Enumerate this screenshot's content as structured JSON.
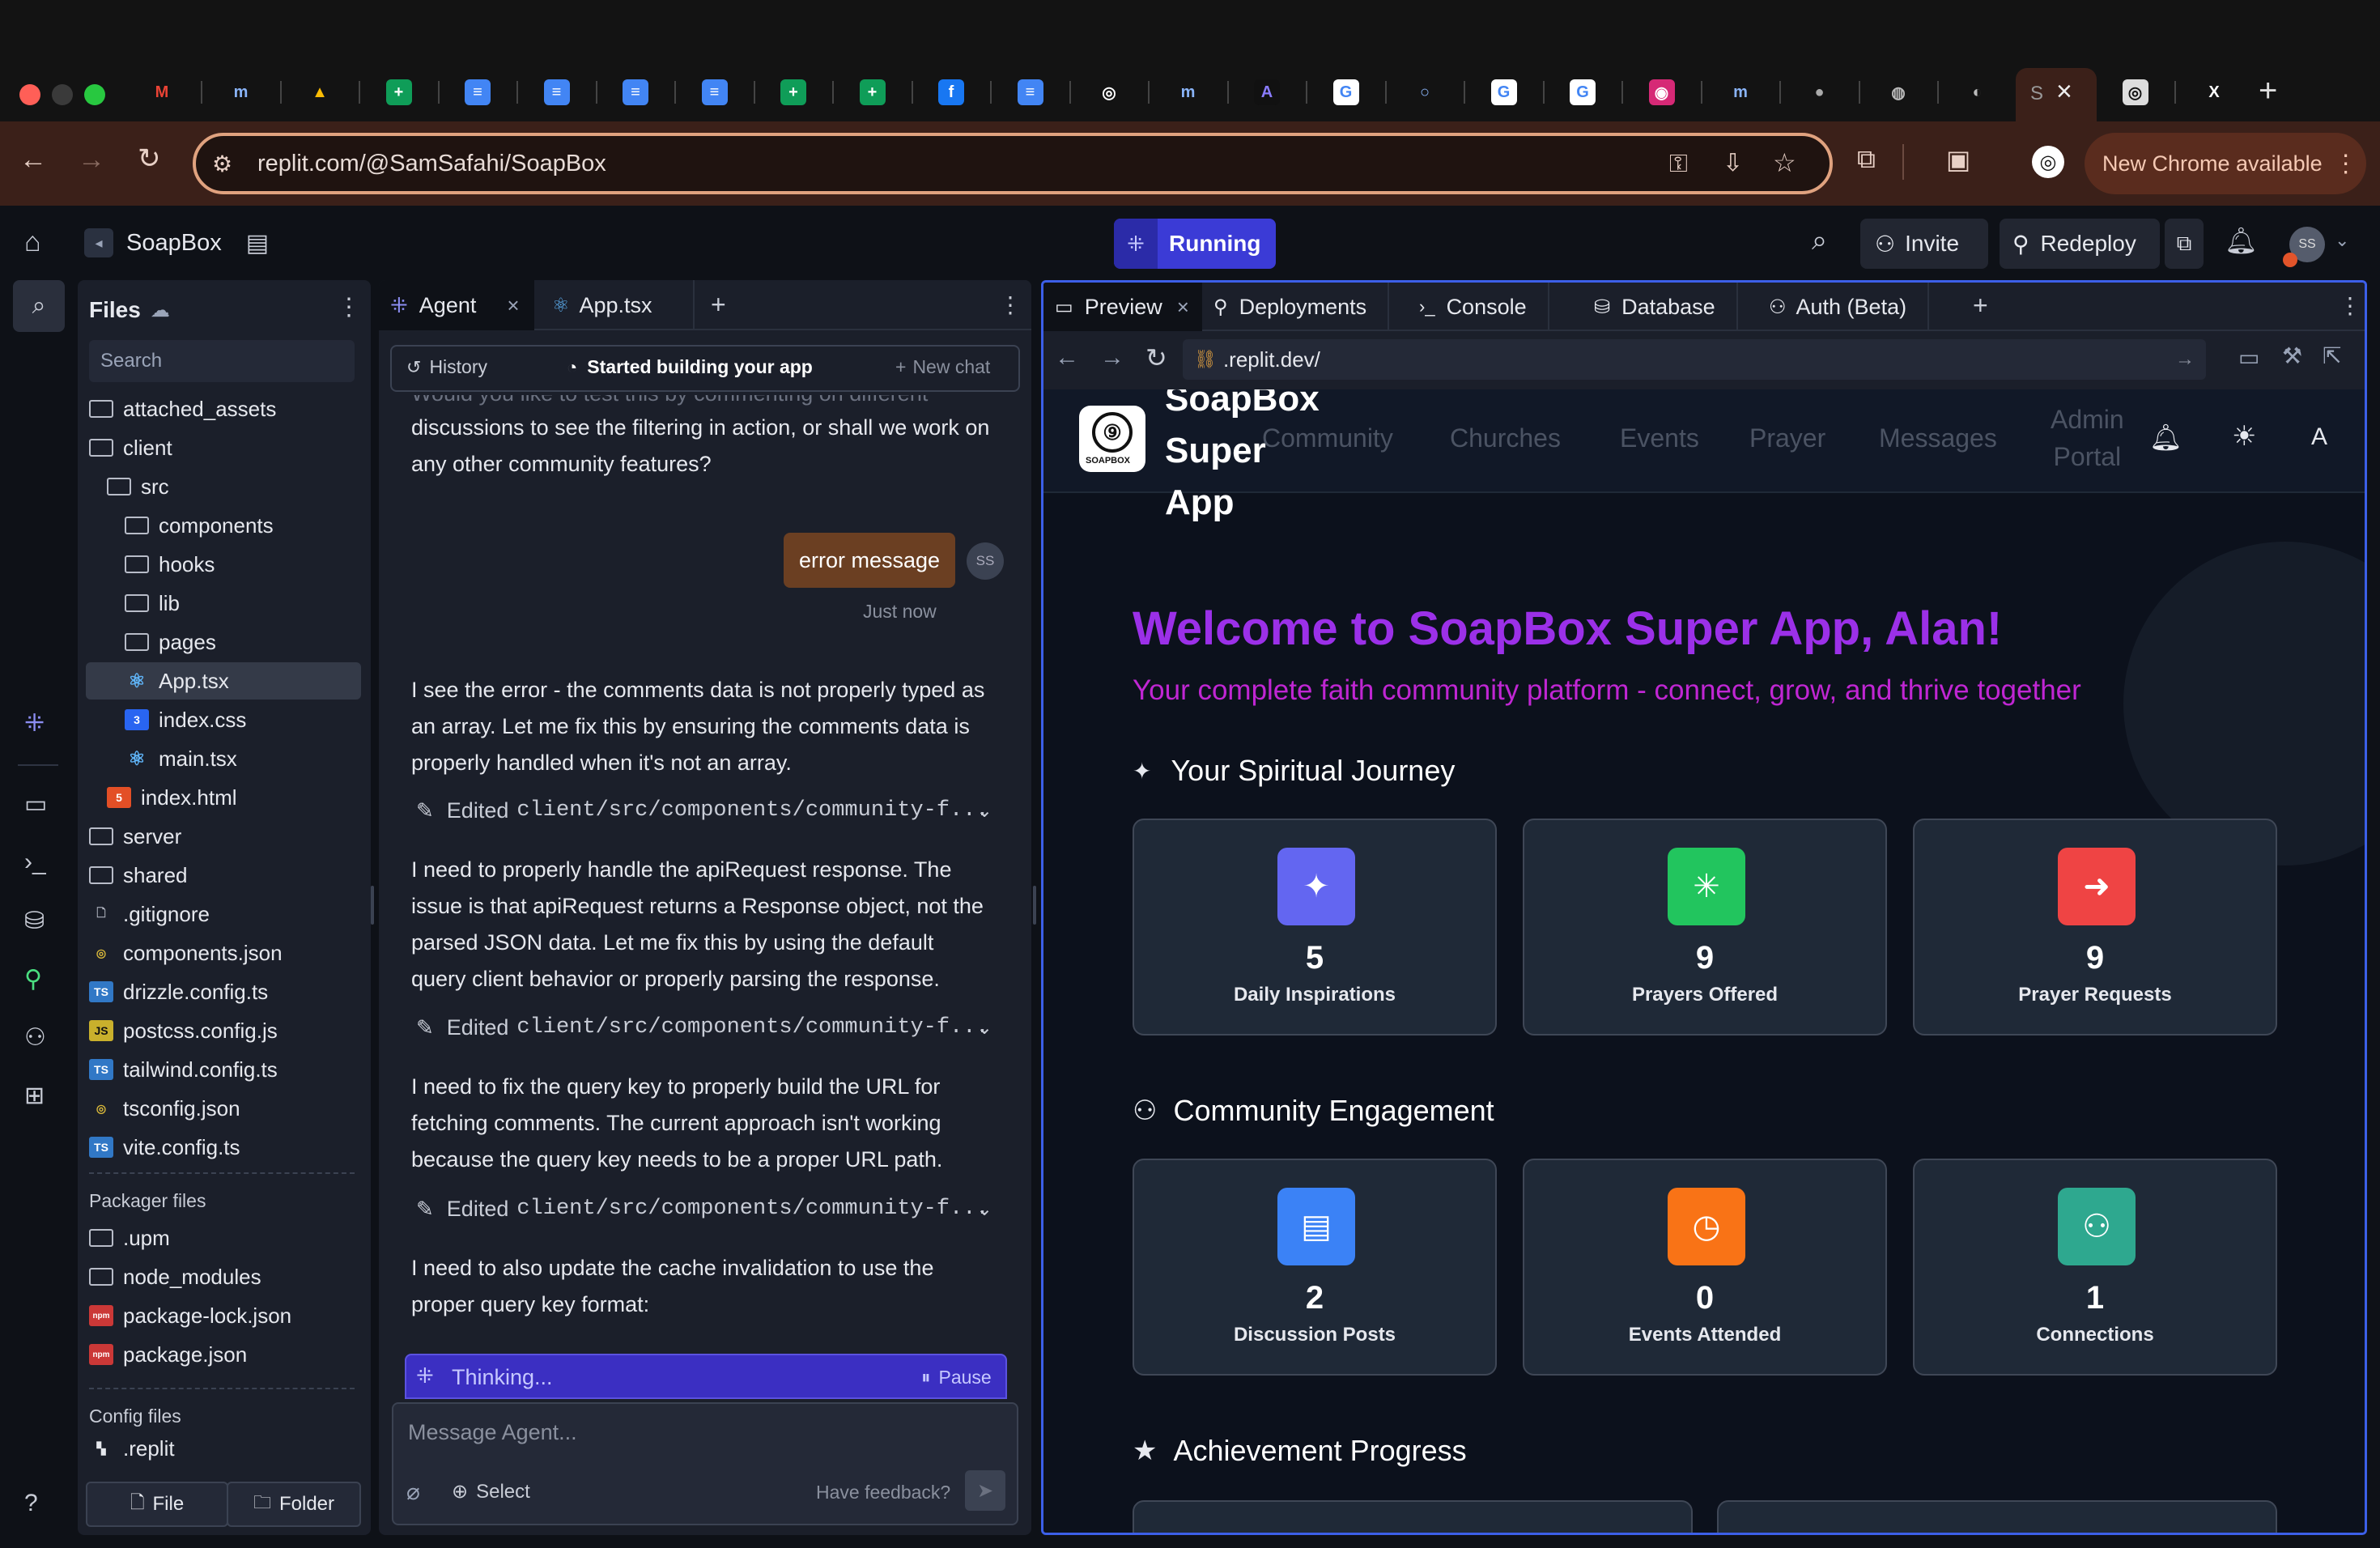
{
  "browser": {
    "url": "replit.com/@SamSafahi/SoapBox",
    "new_chrome": "New Chrome available",
    "tabs": [
      {
        "icon": "gmail-icon",
        "glyph": "M",
        "color": "#ea4335",
        "bg": "transparent"
      },
      {
        "icon": "meet-icon",
        "glyph": "m",
        "color": "#8ab4f8",
        "bg": "transparent"
      },
      {
        "icon": "drive-icon",
        "glyph": "▲",
        "color": "#fbbc04",
        "bg": "transparent"
      },
      {
        "icon": "sheets-icon",
        "glyph": "+",
        "color": "#fff",
        "bg": "#0f9d58"
      },
      {
        "icon": "docs-icon",
        "glyph": "≡",
        "color": "#fff",
        "bg": "#4285f4"
      },
      {
        "icon": "docs-icon",
        "glyph": "≡",
        "color": "#fff",
        "bg": "#4285f4"
      },
      {
        "icon": "docs-icon",
        "glyph": "≡",
        "color": "#fff",
        "bg": "#4285f4"
      },
      {
        "icon": "docs-icon",
        "glyph": "≡",
        "color": "#fff",
        "bg": "#4285f4"
      },
      {
        "icon": "sheets-icon",
        "glyph": "+",
        "color": "#fff",
        "bg": "#0f9d58"
      },
      {
        "icon": "sheets-icon",
        "glyph": "+",
        "color": "#fff",
        "bg": "#0f9d58"
      },
      {
        "icon": "facebook-icon",
        "glyph": "f",
        "color": "#fff",
        "bg": "#1877f2"
      },
      {
        "icon": "docs-icon",
        "glyph": "≡",
        "color": "#fff",
        "bg": "#4285f4"
      },
      {
        "icon": "openai-icon",
        "glyph": "◎",
        "color": "#fff",
        "bg": "transparent"
      },
      {
        "icon": "meet-icon",
        "glyph": "m",
        "color": "#8ab4f8",
        "bg": "transparent"
      },
      {
        "icon": "app-icon",
        "glyph": "A",
        "color": "#8a7cff",
        "bg": "#111"
      },
      {
        "icon": "google-icon",
        "glyph": "G",
        "color": "#4285f4",
        "bg": "#fff"
      },
      {
        "icon": "circle-icon",
        "glyph": "○",
        "color": "#8ab4f8",
        "bg": "transparent"
      },
      {
        "icon": "google-icon",
        "glyph": "G",
        "color": "#4285f4",
        "bg": "#fff"
      },
      {
        "icon": "google-icon",
        "glyph": "G",
        "color": "#4285f4",
        "bg": "#fff"
      },
      {
        "icon": "instagram-icon",
        "glyph": "◉",
        "color": "#fff",
        "bg": "#d62976"
      },
      {
        "icon": "meet-icon",
        "glyph": "m",
        "color": "#8ab4f8",
        "bg": "transparent"
      },
      {
        "icon": "apple-icon",
        "glyph": "●",
        "color": "#aaa",
        "bg": "transparent"
      },
      {
        "icon": "chrome-icon",
        "glyph": "◍",
        "color": "#bbb",
        "bg": "transparent"
      },
      {
        "icon": "globe-icon",
        "glyph": "◐",
        "color": "#bbb",
        "bg": "transparent"
      },
      {
        "icon": "replit-tab-icon",
        "glyph": "S",
        "color": "#bbb",
        "bg": "transparent"
      },
      {
        "icon": "openai-icon",
        "glyph": "◎",
        "color": "#111",
        "bg": "#ddd"
      },
      {
        "icon": "x-icon",
        "glyph": "X",
        "color": "#fff",
        "bg": "transparent"
      }
    ]
  },
  "header": {
    "project": "SoapBox",
    "status": "Running",
    "invite": "Invite",
    "redeploy": "Redeploy",
    "avatar": "SS"
  },
  "files": {
    "title": "Files",
    "search_placeholder": "Search",
    "tree": [
      {
        "name": "attached_assets",
        "type": "folder",
        "indent": 0
      },
      {
        "name": "client",
        "type": "folder",
        "indent": 0
      },
      {
        "name": "src",
        "type": "folder",
        "indent": 1
      },
      {
        "name": "components",
        "type": "folder",
        "indent": 2
      },
      {
        "name": "hooks",
        "type": "folder",
        "indent": 2
      },
      {
        "name": "lib",
        "type": "folder",
        "indent": 2
      },
      {
        "name": "pages",
        "type": "folder",
        "indent": 2
      },
      {
        "name": "App.tsx",
        "type": "react",
        "indent": 2,
        "selected": true
      },
      {
        "name": "index.css",
        "type": "css",
        "indent": 2
      },
      {
        "name": "main.tsx",
        "type": "react",
        "indent": 2
      },
      {
        "name": "index.html",
        "type": "html",
        "indent": 1
      },
      {
        "name": "server",
        "type": "folder",
        "indent": 0
      },
      {
        "name": "shared",
        "type": "folder",
        "indent": 0
      },
      {
        "name": ".gitignore",
        "type": "file",
        "indent": 0
      },
      {
        "name": "components.json",
        "type": "json",
        "indent": 0
      },
      {
        "name": "drizzle.config.ts",
        "type": "ts",
        "indent": 0
      },
      {
        "name": "postcss.config.js",
        "type": "js",
        "indent": 0
      },
      {
        "name": "tailwind.config.ts",
        "type": "ts",
        "indent": 0
      },
      {
        "name": "tsconfig.json",
        "type": "json",
        "indent": 0
      },
      {
        "name": "vite.config.ts",
        "type": "ts",
        "indent": 0
      }
    ],
    "packager_title": "Packager files",
    "packager": [
      {
        "name": ".upm",
        "type": "folder"
      },
      {
        "name": "node_modules",
        "type": "folder"
      },
      {
        "name": "package-lock.json",
        "type": "npm"
      },
      {
        "name": "package.json",
        "type": "npm"
      }
    ],
    "config_title": "Config files",
    "config": [
      {
        "name": ".replit",
        "type": "replit"
      }
    ],
    "new_file": "File",
    "new_folder": "Folder"
  },
  "agent": {
    "tab_agent": "Agent",
    "tab_app": "App.tsx",
    "history": "History",
    "started": "Started building your app",
    "new_chat": "New chat",
    "cut_line": "Would you like to test this by commenting on different",
    "msg0": "discussions to see the filtering in action, or shall we work on any other community features?",
    "user_msg": "error message",
    "user_avatar": "SS",
    "user_time": "Just now",
    "msg1": "I see the error - the comments data is not properly typed as an array. Let me fix this by ensuring the comments data is properly handled when it's not an array.",
    "edited_prefix": "Edited",
    "edited_path": "client/src/components/community-f...",
    "msg2": "I need to properly handle the apiRequest response. The issue is that apiRequest returns a Response object, not the parsed JSON data. Let me fix this by using the default query client behavior or properly parsing the response.",
    "msg3": "I need to fix the query key to properly build the URL for fetching comments. The current approach isn't working because the query key needs to be a proper URL path.",
    "msg4": "I need to also update the cache invalidation to use the proper query key format:",
    "thinking": "Thinking...",
    "pause": "Pause",
    "input_placeholder": "Message Agent...",
    "select": "Select",
    "feedback": "Have feedback?"
  },
  "preview_panel": {
    "tabs": [
      "Preview",
      "Deployments",
      "Console",
      "Database",
      "Auth (Beta)"
    ],
    "url": ".replit.dev/"
  },
  "app": {
    "brand_lines": [
      "SoapBox",
      "Super",
      "App"
    ],
    "logo_text": "SOAPBOX",
    "nav": [
      "Community",
      "Churches",
      "Events",
      "Prayer",
      "Messages"
    ],
    "nav_admin": [
      "Admin",
      "Portal"
    ],
    "user_initial": "A",
    "welcome": "Welcome to SoapBox Super App, Alan!",
    "tagline": "Your complete faith community platform - connect, grow, and thrive together",
    "section1": "Your Spiritual Journey",
    "section2": "Community Engagement",
    "section3": "Achievement Progress",
    "cards1": [
      {
        "value": "5",
        "label": "Daily Inspirations",
        "color": "#6366f1",
        "icon": "sparkles-icon"
      },
      {
        "value": "9",
        "label": "Prayers Offered",
        "color": "#22c55e",
        "icon": "loader-icon"
      },
      {
        "value": "9",
        "label": "Prayer Requests",
        "color": "#ef4444",
        "icon": "arrow-right-icon"
      }
    ],
    "cards2": [
      {
        "value": "2",
        "label": "Discussion Posts",
        "color": "#3b82f6",
        "icon": "message-icon"
      },
      {
        "value": "0",
        "label": "Events Attended",
        "color": "#f97316",
        "icon": "clock-icon"
      },
      {
        "value": "1",
        "label": "Connections",
        "color": "#2ea88f",
        "icon": "users-icon"
      }
    ]
  },
  "colors": {
    "accent": "#9b30e8",
    "tagline": "#c026d3",
    "running": "#3b3bd6"
  }
}
